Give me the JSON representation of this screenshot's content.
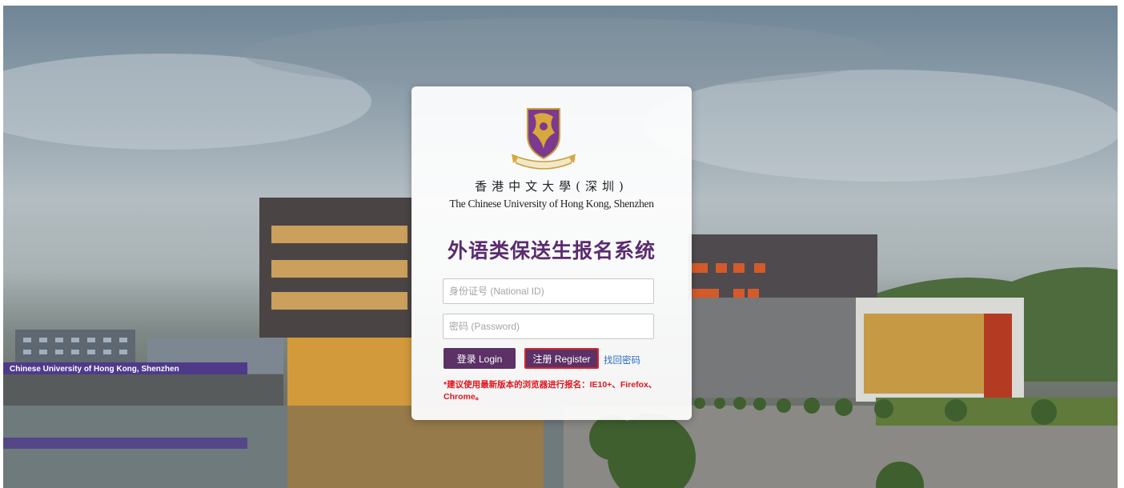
{
  "background": {
    "banner_text": "Chinese University of Hong Kong, Shenzhen"
  },
  "card": {
    "crest": {
      "icon": "cuhk-crest-icon"
    },
    "university_cn": "香港中文大學(深圳)",
    "university_en": "The Chinese University of Hong Kong, Shenzhen",
    "title": "外语类保送生报名系统",
    "id_field": {
      "placeholder": "身份证号 (National ID)",
      "value": ""
    },
    "password_field": {
      "placeholder": "密码 (Password)",
      "value": ""
    },
    "login_button": "登录 Login",
    "register_button": "注册  Register",
    "forgot_link": "找回密码",
    "notice": "*建议使用最新版本的浏览器进行报名：IE10+、Firefox、Chrome。"
  },
  "colors": {
    "accent": "#5b3166",
    "title": "#5b2c6f",
    "register_border": "#d4262c",
    "link": "#2b6cc4",
    "notice": "#e0141b"
  }
}
